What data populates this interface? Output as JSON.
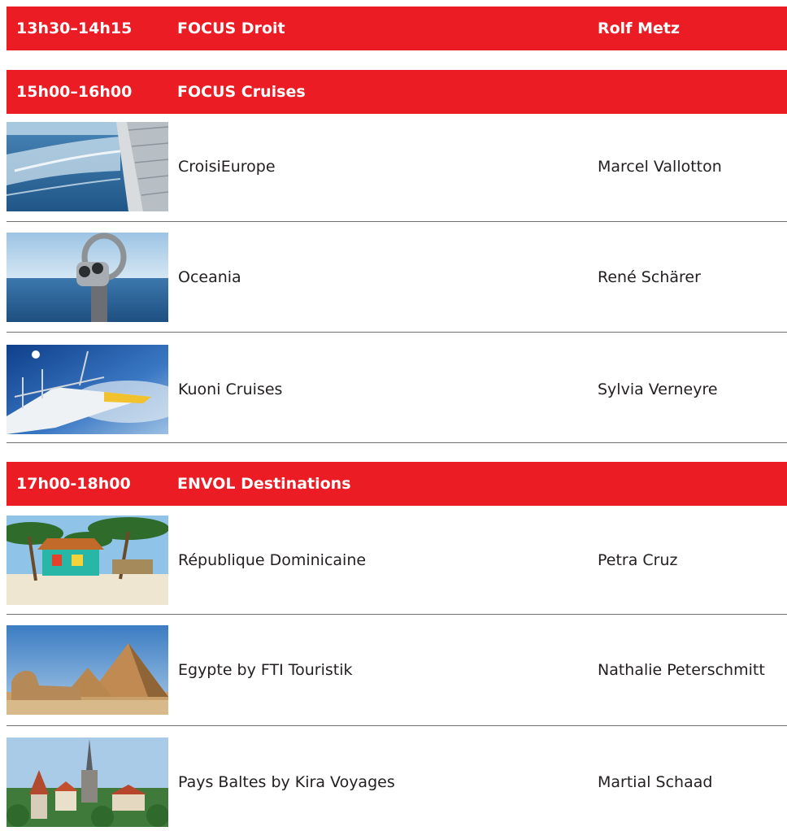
{
  "sessions": [
    {
      "time": "13h30–14h15",
      "title": "FOCUS Droit",
      "speaker": "Rolf Metz",
      "items": []
    },
    {
      "time": "15h00–16h00",
      "title": "FOCUS Cruises",
      "speaker": "",
      "items": [
        {
          "topic": "CroisiEurope",
          "person": "Marcel Vallotton",
          "image": "cruise-ship-wake-photo"
        },
        {
          "topic": "Oceania",
          "person": "René Schärer",
          "image": "coin-binoculars-sea-photo"
        },
        {
          "topic": "Kuoni Cruises",
          "person": "Sylvia Verneyre",
          "image": "ship-bow-sky-photo"
        }
      ]
    },
    {
      "time": "17h00-18h00",
      "title": "ENVOL Destinations",
      "speaker": "",
      "items": [
        {
          "topic": "République Dominicaine",
          "person": "Petra Cruz",
          "image": "beach-hut-palms-photo"
        },
        {
          "topic": "Egypte by FTI Touristik",
          "person": "Nathalie Peterschmitt",
          "image": "pyramids-sphinx-photo"
        },
        {
          "topic": "Pays Baltes by Kira Voyages",
          "person": "Martial Schaad",
          "image": "tallinn-old-town-photo"
        }
      ]
    }
  ],
  "colors": {
    "band": "#ec1c24",
    "band_text": "#ffffff",
    "text": "#231f20",
    "rule": "#6d6e71"
  }
}
